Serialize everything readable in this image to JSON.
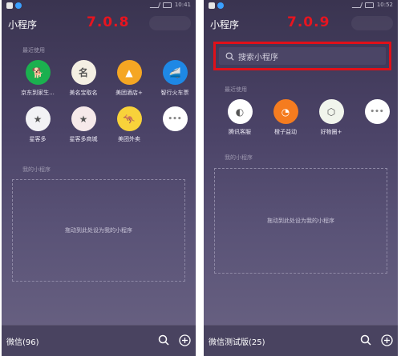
{
  "left": {
    "status_time": "10:41",
    "title": "小程序",
    "version": "7.0.8",
    "recent_label": "最近使用",
    "recent_items": [
      {
        "label": "京东到家生...",
        "icon_glyph": "🐕",
        "badge": "京东到家",
        "color": "#1bb04f",
        "icon": "jd-daojia-icon"
      },
      {
        "label": "美名宝取名",
        "icon_glyph": "名",
        "color": "#f4efe3",
        "icon": "meiming-icon"
      },
      {
        "label": "美团酒店+",
        "icon_glyph": "▲",
        "color": "#f5a623",
        "icon": "meituan-hotel-icon"
      },
      {
        "label": "智行火车票",
        "icon_glyph": "🚄",
        "color": "#1e88e5",
        "icon": "zhixing-train-icon"
      },
      {
        "label": "星客多",
        "icon_glyph": "★",
        "color": "#f2f2f5",
        "icon": "xingkeduo-icon"
      },
      {
        "label": "星客多商城",
        "icon_glyph": "★",
        "color": "#f6e9ea",
        "icon": "xingkeduo-mall-icon"
      },
      {
        "label": "美团外卖",
        "icon_glyph": "🦘",
        "color": "#f8d23a",
        "icon": "meituan-waimai-icon"
      },
      {
        "label": "",
        "icon_glyph": "•••",
        "color": "#ffffff",
        "icon": "more-icon"
      }
    ],
    "mine_label": "我的小程序",
    "drop_hint": "拖动到此处设为我的小程序",
    "bottom_name": "微信(96)"
  },
  "right": {
    "status_time": "10:52",
    "title": "小程序",
    "version": "7.0.9",
    "search_placeholder": "搜索小程序",
    "recent_label": "最近使用",
    "recent_items": [
      {
        "label": "腾讯客服",
        "icon_glyph": "◐",
        "color": "#ffffff",
        "icon": "tencent-service-icon"
      },
      {
        "label": "橙子益动",
        "icon_glyph": "◔",
        "color": "#f57c1f",
        "icon": "chengzi-icon"
      },
      {
        "label": "好物圈+",
        "icon_glyph": "⬡",
        "color": "#f1f5ec",
        "icon": "haowuquan-icon"
      },
      {
        "label": "",
        "icon_glyph": "•••",
        "color": "#ffffff",
        "icon": "more-icon"
      }
    ],
    "mine_label": "我的小程序",
    "drop_hint": "拖动到此处设为我的小程序",
    "bottom_name": "微信测试版(25)"
  },
  "colors": {
    "version_red": "#e8141f",
    "highlight_red": "#e01019"
  }
}
